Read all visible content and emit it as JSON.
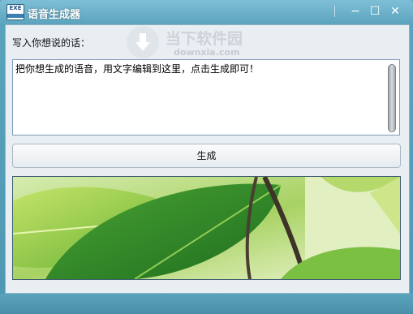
{
  "window": {
    "title": "语音生成器",
    "icon": "app-document-icon",
    "icon_text": "EXE"
  },
  "controls": {
    "minimize": "−",
    "maximize": "☐",
    "close": "✕"
  },
  "form": {
    "prompt_label": "写入你想说的话：",
    "textarea_value": "把你想生成的语音，用文字编辑到这里，点击生成即可！",
    "generate_label": "生成"
  },
  "banner": {
    "image": "green-leaves-photo"
  },
  "watermark": {
    "text": "当下软件园",
    "url": "downxia.com"
  },
  "colors": {
    "frame": "#5aa3bd",
    "client": "#e9eef2",
    "leaf_light": "#b8dc5a",
    "leaf_dark": "#2f8a2a"
  }
}
